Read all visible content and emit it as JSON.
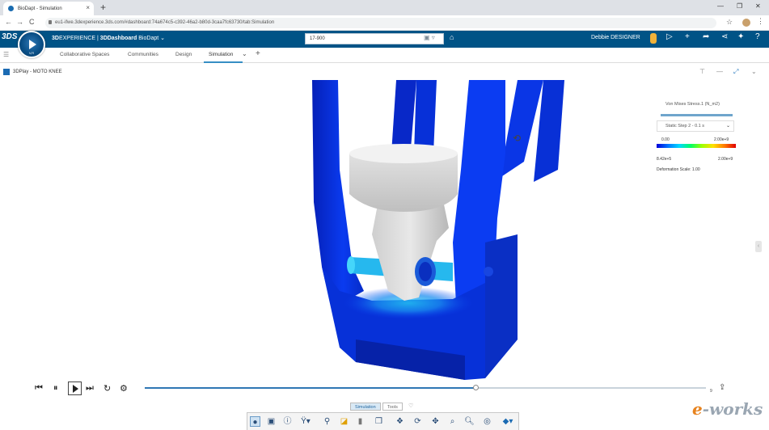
{
  "browser": {
    "tab_title": "BioDapt - Simulation",
    "tab_close": "×",
    "new_tab": "+",
    "url": "eu1-ifwe.3dexperience.3ds.com/#dashboard:74a674c5-c392-46a2-b80d-3caa7fc63730/tab:Simulation",
    "back": "←",
    "forward": "→",
    "reload": "C",
    "star": "☆",
    "menu": "⋮",
    "min": "—",
    "max": "❐",
    "close": "✕"
  },
  "topbar": {
    "logo": "3DS",
    "compass_label": "V,R",
    "brand_prefix": "3D",
    "brand_mid": "EXPERIENCE | ",
    "brand_app": "3DDashboard",
    "brand_space": "BioDapt",
    "brand_caret": "⌄",
    "search_value": "17-900",
    "user": "Debbie DESIGNER"
  },
  "tabs": {
    "items": [
      "Collaborative Spaces",
      "Communities",
      "Design",
      "Simulation"
    ],
    "active": "Simulation",
    "add": "+"
  },
  "app": {
    "title": "3DPlay - MOTO KNEE"
  },
  "legend": {
    "title": "Von Mises Stress.1 (N_m2)",
    "step": "Static Step 2 - 0.1 s",
    "min_label": "0.00",
    "max_label": "2.00e+9",
    "low_value": "8.42e+5",
    "high_value": "2.00e+9",
    "deformation_scale": "Deformation Scale: 1.00"
  },
  "playback": {
    "progress": 0.59,
    "end_label": "9"
  },
  "bottom": {
    "tab_simulation": "Simulation",
    "tab_tools": "Tools",
    "heart": "♡"
  },
  "watermark": {
    "e": "e",
    "rest": "-works"
  },
  "colors": {
    "blue_part": "#0a33e0",
    "accent": "#005386"
  }
}
